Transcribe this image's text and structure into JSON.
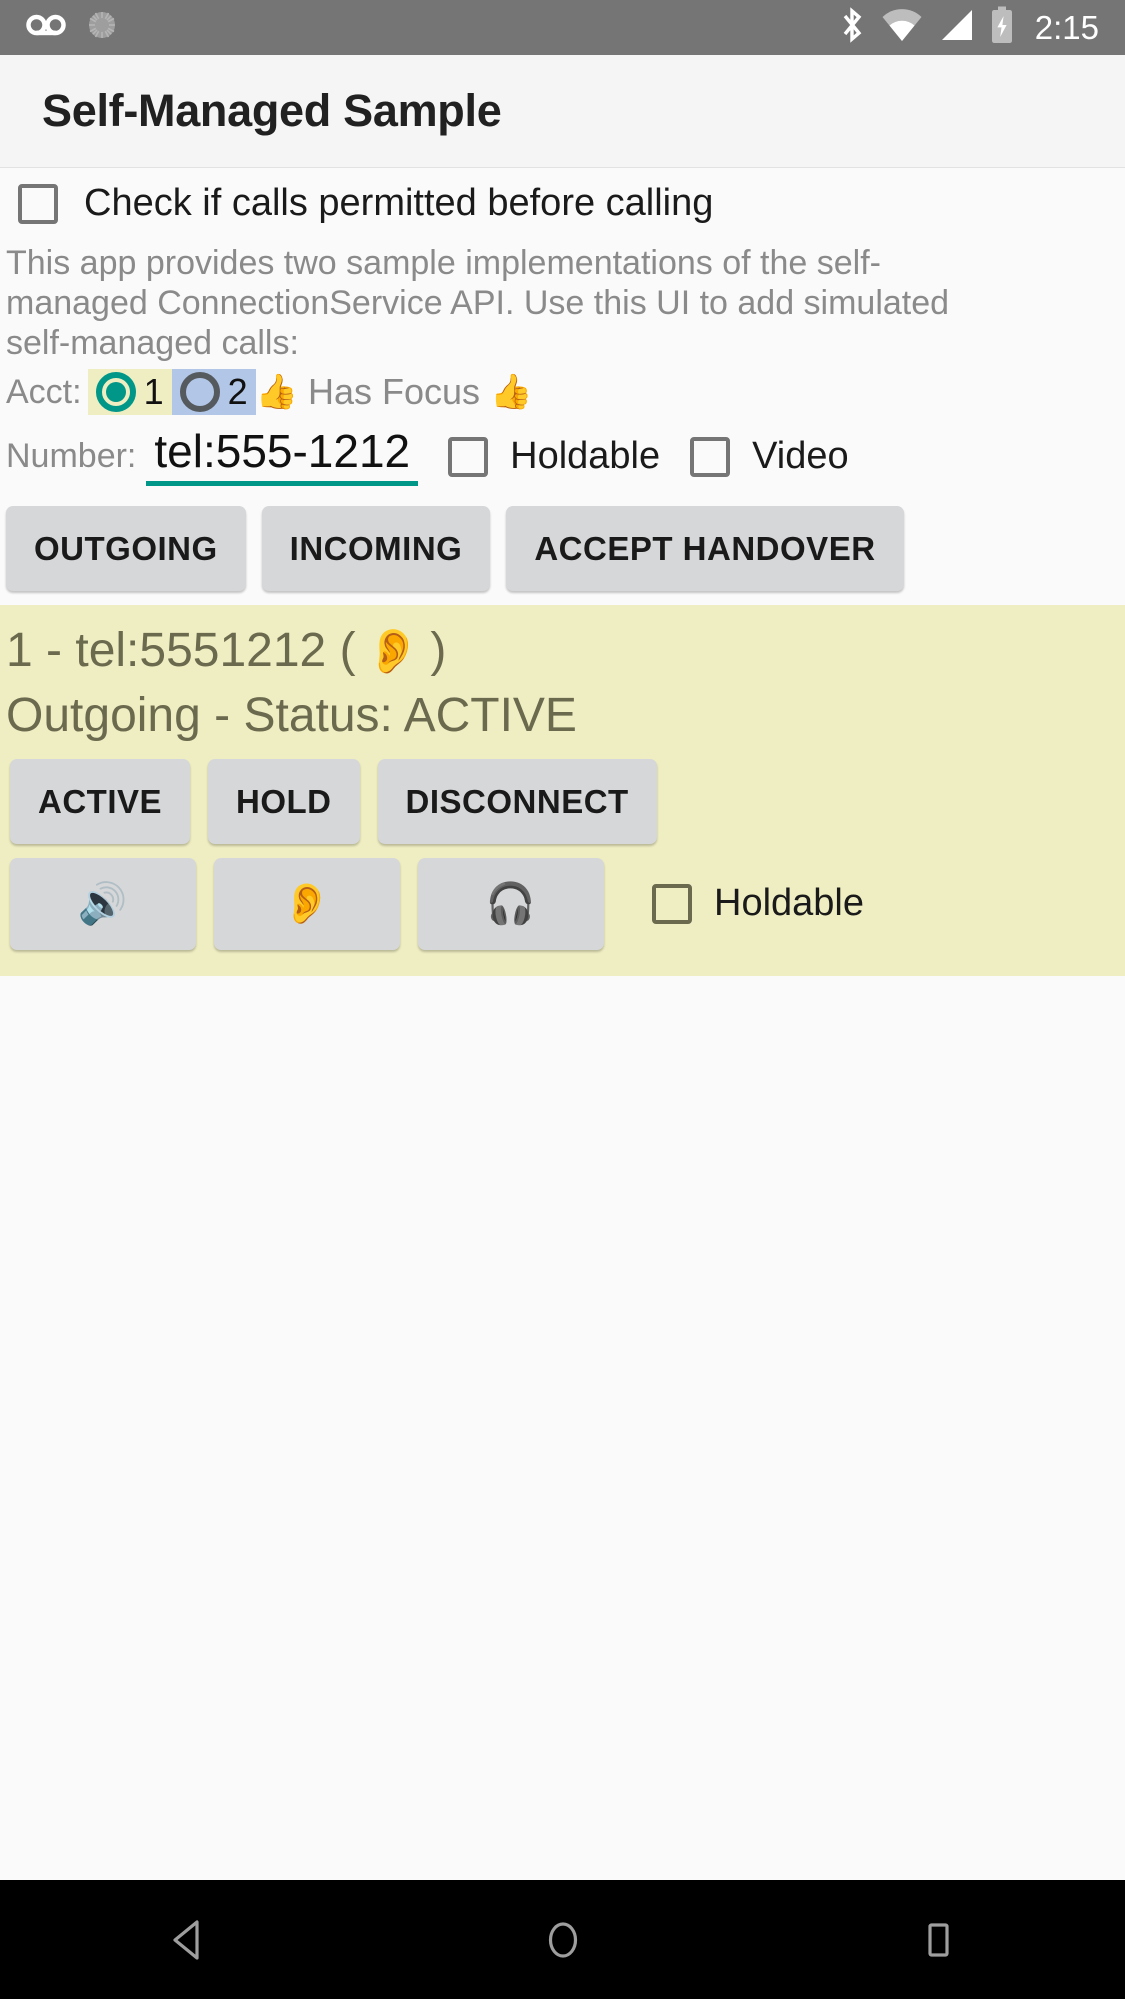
{
  "status_bar": {
    "icons_left": [
      "voicemail-icon",
      "sync-spinner-icon"
    ],
    "icons_right": [
      "bluetooth-icon",
      "wifi-icon",
      "cellular-signal-icon",
      "battery-charging-icon"
    ],
    "clock": "2:15",
    "background_color": "#757575"
  },
  "app_bar": {
    "title": "Self-Managed Sample",
    "background_color": "#f5f5f5"
  },
  "permit_check": {
    "label": "Check if calls permitted before calling",
    "checked": false
  },
  "description": "This app provides two sample implementations of the self-managed ConnectionService API.  Use this UI to add simulated self-managed calls:",
  "account_row": {
    "label": "Acct:",
    "options": [
      {
        "value": "1",
        "selected": true,
        "chip_color": "#efeec2",
        "radio_color": "#009688"
      },
      {
        "value": "2",
        "selected": false,
        "chip_color": "#b2c6e7",
        "radio_color": "#555a5e"
      }
    ],
    "focus_text": "Has Focus",
    "thumb_left": "👍",
    "thumb_right": "👍"
  },
  "number_row": {
    "label": "Number:",
    "value": "tel:555-1212",
    "placeholder": "tel:555-1212",
    "underline_color": "#009688",
    "holdable": {
      "label": "Holdable",
      "checked": false
    },
    "video": {
      "label": "Video",
      "checked": false
    }
  },
  "action_buttons": [
    {
      "label": "OUTGOING",
      "name": "outgoing-button"
    },
    {
      "label": "INCOMING",
      "name": "incoming-button"
    },
    {
      "label": "ACCEPT HANDOVER",
      "name": "accept-handover-button"
    }
  ],
  "call_card": {
    "background_color": "#efeec2",
    "text_color": "#6b6a4f",
    "title_prefix": "1 - tel:5551212 (",
    "title_emoji": "👂",
    "title_suffix": ")",
    "status_line": "Outgoing - Status: ACTIVE",
    "state_buttons": [
      {
        "label": "ACTIVE",
        "name": "call-active-button"
      },
      {
        "label": "HOLD",
        "name": "call-hold-button"
      },
      {
        "label": "DISCONNECT",
        "name": "call-disconnect-button"
      }
    ],
    "audio_buttons": [
      {
        "label": "🔊",
        "name": "audio-route-speaker-button"
      },
      {
        "label": "👂",
        "name": "audio-route-earpiece-button"
      },
      {
        "label": "🎧",
        "name": "audio-route-headset-button"
      }
    ],
    "holdable": {
      "label": "Holdable",
      "checked": false
    }
  },
  "nav_bar": {
    "background_color": "#000000",
    "buttons": [
      "back-nav-button",
      "home-nav-button",
      "recents-nav-button"
    ]
  }
}
